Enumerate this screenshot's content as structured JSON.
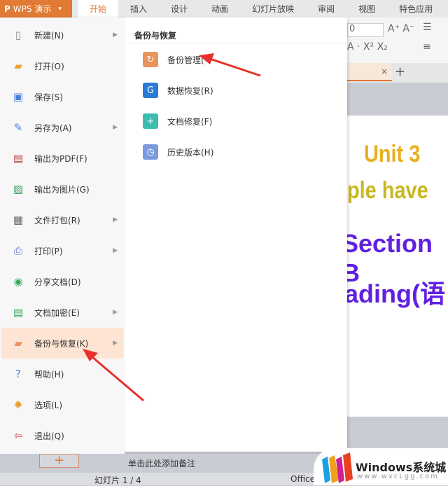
{
  "app": {
    "title": "WPS 演示",
    "menu_arrow": "▾"
  },
  "tabs": [
    "开始",
    "插入",
    "设计",
    "动画",
    "幻灯片放映",
    "审阅",
    "视图",
    "特色应用"
  ],
  "menu": {
    "items": [
      {
        "label": "新建(N)",
        "icon": "new-file-icon",
        "submenu": true
      },
      {
        "label": "打开(O)",
        "icon": "folder-open-icon",
        "submenu": false
      },
      {
        "label": "保存(S)",
        "icon": "save-icon",
        "submenu": false
      },
      {
        "label": "另存为(A)",
        "icon": "save-as-icon",
        "submenu": true
      },
      {
        "label": "输出为PDF(F)",
        "icon": "pdf-icon",
        "submenu": false
      },
      {
        "label": "输出为图片(G)",
        "icon": "image-icon",
        "submenu": false
      },
      {
        "label": "文件打包(R)",
        "icon": "package-icon",
        "submenu": true
      },
      {
        "label": "打印(P)",
        "icon": "print-icon",
        "submenu": true
      },
      {
        "label": "分享文档(D)",
        "icon": "share-icon",
        "submenu": false
      },
      {
        "label": "文档加密(E)",
        "icon": "lock-file-icon",
        "submenu": true
      },
      {
        "label": "备份与恢复(K)",
        "icon": "backup-icon",
        "submenu": true,
        "highlighted": true
      },
      {
        "label": "帮助(H)",
        "icon": "help-icon",
        "submenu": false
      },
      {
        "label": "选项(L)",
        "icon": "gear-icon",
        "submenu": false
      },
      {
        "label": "退出(Q)",
        "icon": "exit-icon",
        "submenu": false
      }
    ]
  },
  "submenu": {
    "title": "备份与恢复",
    "items": [
      {
        "label": "备份管理(",
        "icon": "backup-folder-icon",
        "color": "#e8945a"
      },
      {
        "label": "数据恢复(R)",
        "icon": "data-recovery-icon",
        "color": "#2a7bd4"
      },
      {
        "label": "文档修复(F)",
        "icon": "doc-repair-icon",
        "color": "#3dbcb0"
      },
      {
        "label": "历史版本(H)",
        "icon": "history-icon",
        "color": "#7a9ae0"
      }
    ]
  },
  "slide": {
    "line1": "Unit 3",
    "line2": "ple have",
    "line3": "Section B",
    "line4": "ading(语"
  },
  "ribbon": {
    "font_size": "0"
  },
  "notes": {
    "placeholder": "单击此处添加备注",
    "add": "+"
  },
  "status": {
    "slide": "幻灯片 1 / 4",
    "theme": "Office"
  },
  "doctab": {
    "close": "×",
    "new": "+"
  },
  "watermark": {
    "title": "Windows系统城",
    "url": "www.wxcLgg.com"
  },
  "colors": {
    "accent": "#e07a34",
    "highlight": "#fde4d3",
    "arrow": "#e8302a"
  }
}
